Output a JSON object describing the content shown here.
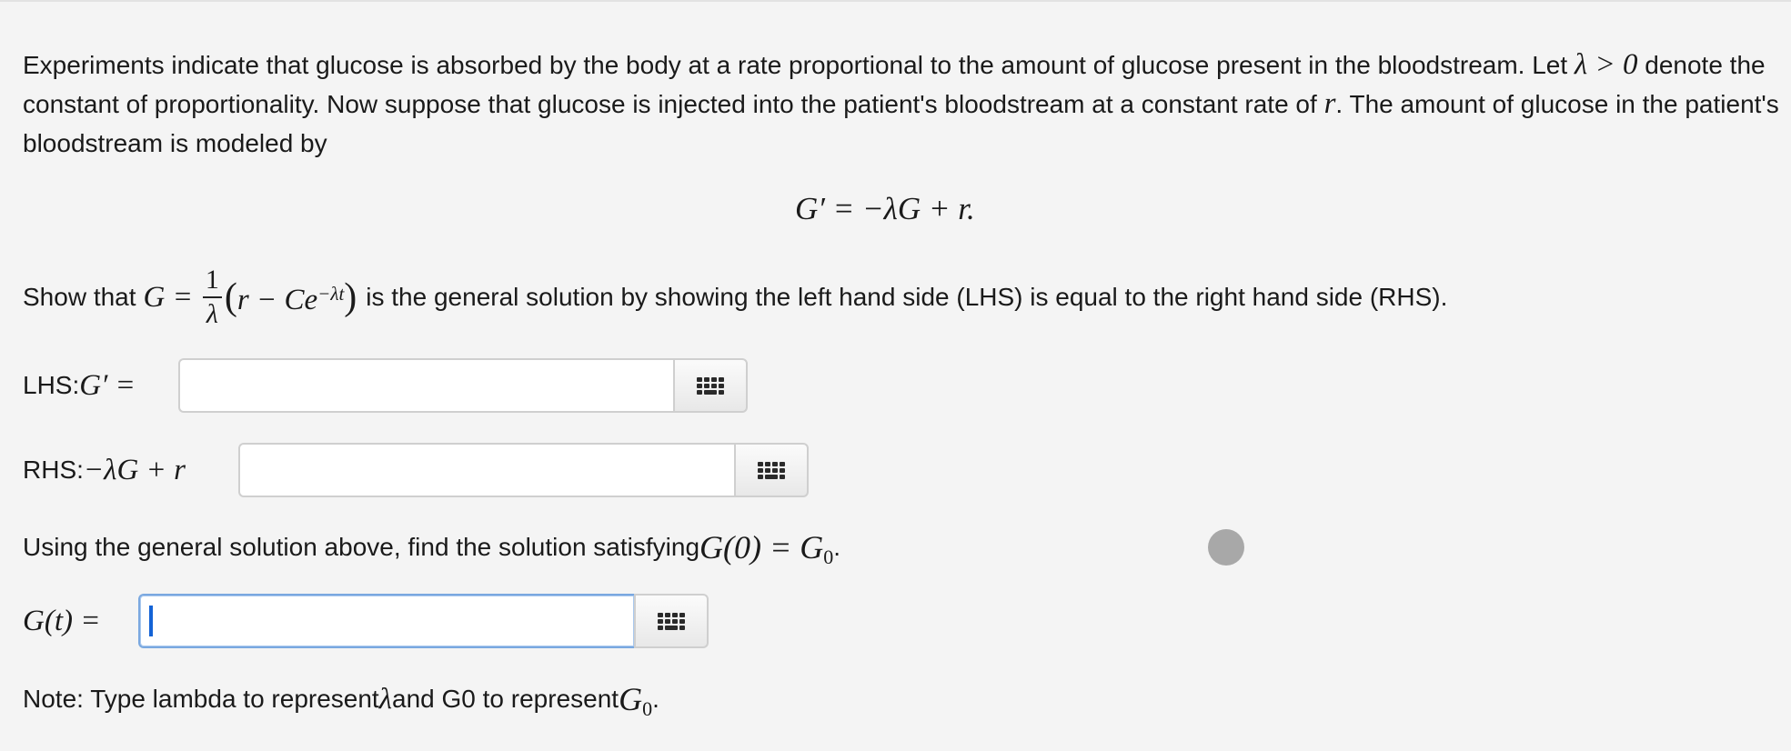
{
  "problem": {
    "intro_part1": "Experiments indicate that glucose is absorbed by the body at a rate proportional to the amount of glucose present in the bloodstream. Let ",
    "intro_math1": "λ > 0",
    "intro_part2": " denote the constant of proportionality. Now suppose that glucose is injected into the patient's bloodstream at a constant rate of ",
    "intro_math2": "r",
    "intro_part3": ". The amount of glucose in the patient's bloodstream is modeled by",
    "display_equation": "G′ = −λG + r.",
    "show_prefix": "Show that ",
    "show_lhs": "G =",
    "show_frac_num": "1",
    "show_frac_den": "λ",
    "show_inner": "r − Ce",
    "show_exponent": "−λt",
    "show_suffix": " is the general solution by showing the left hand side (LHS) is equal to the right hand side (RHS)."
  },
  "lhs": {
    "label_text": "LHS: ",
    "label_math": "G′ =",
    "value": ""
  },
  "rhs": {
    "label_text": "RHS: ",
    "label_math": "−λG + r",
    "value": ""
  },
  "initial_condition": {
    "text": "Using the general solution above, find the solution satisfying ",
    "math": "G(0) = G",
    "math_sub": "0",
    "period": "."
  },
  "solution": {
    "label_math": "G(t) =",
    "value": ""
  },
  "note": {
    "prefix": "Note: Type lambda to represent ",
    "lambda_symbol": "λ",
    "middle": " and G0 to represent ",
    "g_symbol": "G",
    "g_sub": "0",
    "period": "."
  },
  "icons": {
    "keyboard": "keyboard-grid-icon",
    "cursor": "cursor-dot-icon"
  },
  "colors": {
    "background": "#f4f4f4",
    "focus_border": "#7aa8e0",
    "caret": "#1463d6",
    "cursor_dot": "#a8a8a8"
  }
}
